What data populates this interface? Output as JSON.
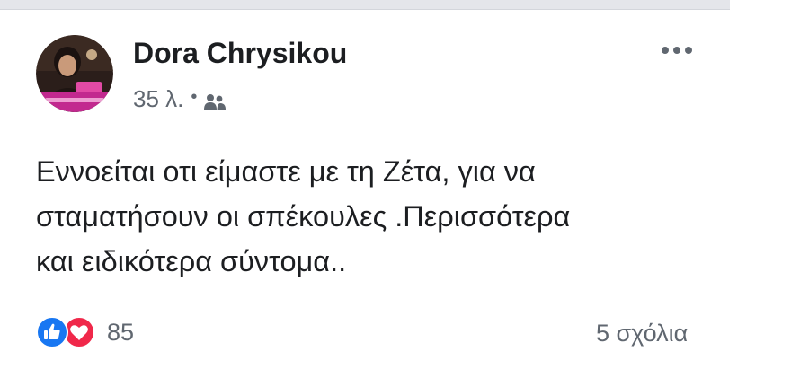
{
  "post": {
    "author_name": "Dora Chrysikou",
    "timestamp": "35 λ.",
    "separator": "•",
    "audience_icon": "friends-icon",
    "more_icon": "more-options-icon",
    "text_lines": [
      "Εννοείται οτι είμαστε με τη Ζέτα, για να",
      "σταματήσουν οι σπέκουλες .Περισσότερα",
      "και ειδικότερα σύντομα.."
    ],
    "reactions": {
      "icons": [
        "like-icon",
        "love-icon"
      ],
      "count": "85"
    },
    "comments_label": "5 σχόλια"
  },
  "colors": {
    "like_blue": "#1877f2",
    "love_red": "#f0284a",
    "secondary_text": "#606770",
    "primary_text": "#1c1e21",
    "avatar_ring": "#c2298f"
  }
}
